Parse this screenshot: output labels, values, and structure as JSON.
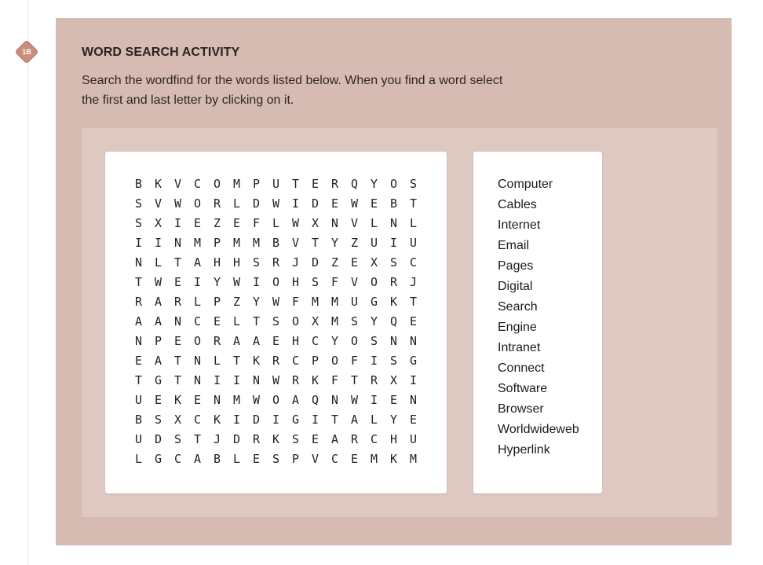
{
  "step": {
    "badge": "1B"
  },
  "activity": {
    "title": "WORD SEARCH ACTIVITY",
    "instructions": "Search the wordfind for the words listed below. When you find a word select the first and last letter by clicking on it."
  },
  "grid": [
    [
      "B",
      "K",
      "V",
      "C",
      "O",
      "M",
      "P",
      "U",
      "T",
      "E",
      "R",
      "Q",
      "Y",
      "O",
      "S"
    ],
    [
      "S",
      "V",
      "W",
      "O",
      "R",
      "L",
      "D",
      "W",
      "I",
      "D",
      "E",
      "W",
      "E",
      "B",
      "T"
    ],
    [
      "S",
      "X",
      "I",
      "E",
      "Z",
      "E",
      "F",
      "L",
      "W",
      "X",
      "N",
      "V",
      "L",
      "N",
      "L"
    ],
    [
      "I",
      "I",
      "N",
      "M",
      "P",
      "M",
      "M",
      "B",
      "V",
      "T",
      "Y",
      "Z",
      "U",
      "I",
      "U"
    ],
    [
      "N",
      "L",
      "T",
      "A",
      "H",
      "H",
      "S",
      "R",
      "J",
      "D",
      "Z",
      "E",
      "X",
      "S",
      "C"
    ],
    [
      "T",
      "W",
      "E",
      "I",
      "Y",
      "W",
      "I",
      "O",
      "H",
      "S",
      "F",
      "V",
      "O",
      "R",
      "J"
    ],
    [
      "R",
      "A",
      "R",
      "L",
      "P",
      "Z",
      "Y",
      "W",
      "F",
      "M",
      "M",
      "U",
      "G",
      "K",
      "T"
    ],
    [
      "A",
      "A",
      "N",
      "C",
      "E",
      "L",
      "T",
      "S",
      "O",
      "X",
      "M",
      "S",
      "Y",
      "Q",
      "E"
    ],
    [
      "N",
      "P",
      "E",
      "O",
      "R",
      "A",
      "A",
      "E",
      "H",
      "C",
      "Y",
      "O",
      "S",
      "N",
      "N"
    ],
    [
      "E",
      "A",
      "T",
      "N",
      "L",
      "T",
      "K",
      "R",
      "C",
      "P",
      "O",
      "F",
      "I",
      "S",
      "G"
    ],
    [
      "T",
      "G",
      "T",
      "N",
      "I",
      "I",
      "N",
      "W",
      "R",
      "K",
      "F",
      "T",
      "R",
      "X",
      "I"
    ],
    [
      "U",
      "E",
      "K",
      "E",
      "N",
      "M",
      "W",
      "O",
      "A",
      "Q",
      "N",
      "W",
      "I",
      "E",
      "N"
    ],
    [
      "B",
      "S",
      "X",
      "C",
      "K",
      "I",
      "D",
      "I",
      "G",
      "I",
      "T",
      "A",
      "L",
      "Y",
      "E"
    ],
    [
      "U",
      "D",
      "S",
      "T",
      "J",
      "D",
      "R",
      "K",
      "S",
      "E",
      "A",
      "R",
      "C",
      "H",
      "U"
    ],
    [
      "L",
      "G",
      "C",
      "A",
      "B",
      "L",
      "E",
      "S",
      "P",
      "V",
      "C",
      "E",
      "M",
      "K",
      "M"
    ]
  ],
  "words": [
    "Computer",
    "Cables",
    "Internet",
    "Email",
    "Pages",
    "Digital",
    "Search",
    "Engine",
    "Intranet",
    "Connect",
    "Software",
    "Browser",
    "Worldwideweb",
    "Hyperlink"
  ],
  "colors": {
    "panel": "#d6bbb2",
    "inner": "#dec9c2",
    "badge": "#c98e7e"
  }
}
